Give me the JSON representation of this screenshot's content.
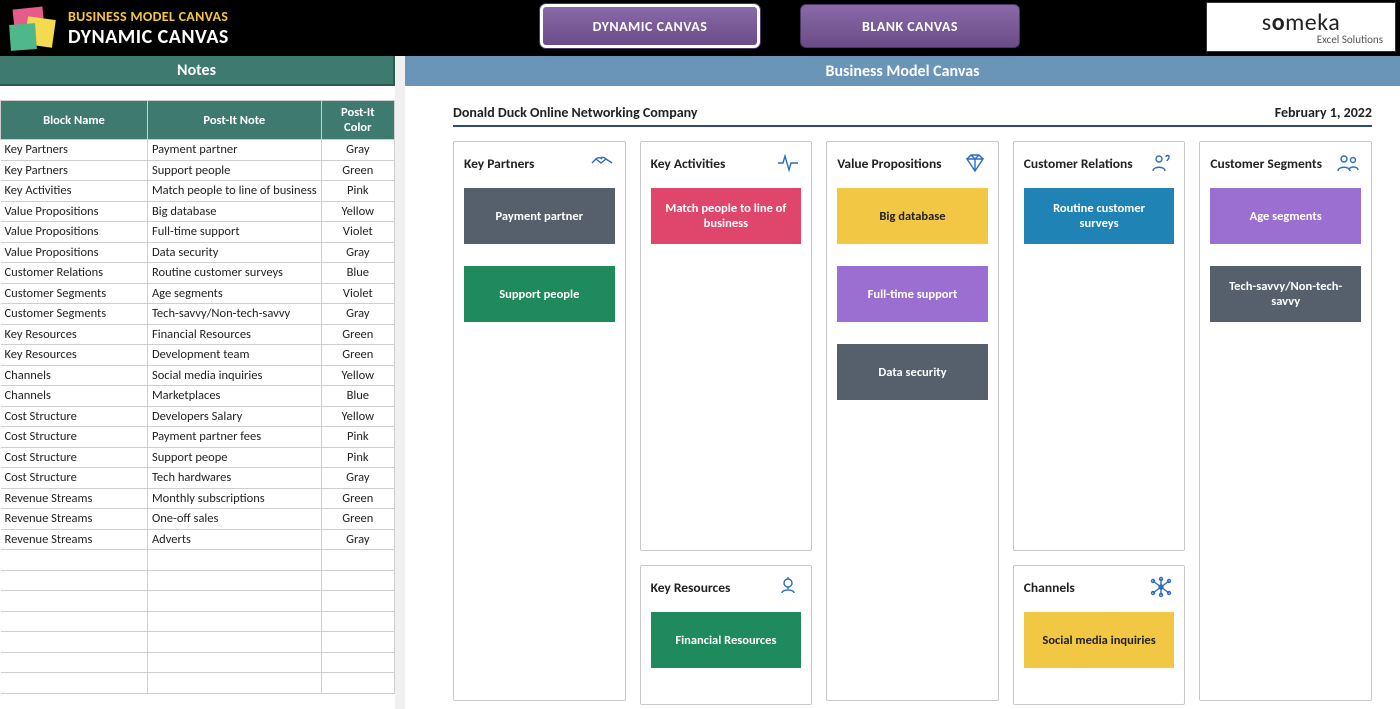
{
  "header": {
    "eyebrow": "BUSINESS MODEL CANVAS",
    "title": "DYNAMIC CANVAS",
    "nav": {
      "dynamic": "DYNAMIC CANVAS",
      "blank": "BLANK CANVAS"
    },
    "brand_main_a": "s",
    "brand_main_b": "o",
    "brand_main_c": "meka",
    "brand_sub": "Excel Solutions"
  },
  "section_headers": {
    "notes": "Notes",
    "canvas": "Business Model Canvas"
  },
  "notes_headers": {
    "block": "Block Name",
    "note": "Post-It Note",
    "color": "Post-It Color"
  },
  "notes": [
    {
      "block": "Key Partners",
      "note": "Payment partner",
      "color": "Gray"
    },
    {
      "block": "Key Partners",
      "note": "Support people",
      "color": "Green"
    },
    {
      "block": "Key Activities",
      "note": "Match people to line of business",
      "color": "Pink"
    },
    {
      "block": "Value Propositions",
      "note": "Big database",
      "color": "Yellow"
    },
    {
      "block": "Value Propositions",
      "note": "Full-time support",
      "color": "Violet"
    },
    {
      "block": "Value Propositions",
      "note": "Data security",
      "color": "Gray"
    },
    {
      "block": "Customer Relations",
      "note": "Routine customer surveys",
      "color": "Blue"
    },
    {
      "block": "Customer Segments",
      "note": "Age segments",
      "color": "Violet"
    },
    {
      "block": "Customer Segments",
      "note": "Tech-savvy/Non-tech-savvy",
      "color": "Gray"
    },
    {
      "block": "Key Resources",
      "note": "Financial Resources",
      "color": "Green"
    },
    {
      "block": "Key Resources",
      "note": "Development team",
      "color": "Green"
    },
    {
      "block": "Channels",
      "note": "Social media inquiries",
      "color": "Yellow"
    },
    {
      "block": "Channels",
      "note": "Marketplaces",
      "color": "Blue"
    },
    {
      "block": "Cost Structure",
      "note": "Developers Salary",
      "color": "Yellow"
    },
    {
      "block": "Cost Structure",
      "note": "Payment partner fees",
      "color": "Pink"
    },
    {
      "block": "Cost Structure",
      "note": "Support peope",
      "color": "Pink"
    },
    {
      "block": "Cost Structure",
      "note": "Tech hardwares",
      "color": "Gray"
    },
    {
      "block": "Revenue Streams",
      "note": "Monthly subscriptions",
      "color": "Green"
    },
    {
      "block": "Revenue Streams",
      "note": "One-off sales",
      "color": "Green"
    },
    {
      "block": "Revenue Streams",
      "note": "Adverts",
      "color": "Gray"
    },
    {
      "block": "",
      "note": "",
      "color": ""
    },
    {
      "block": "",
      "note": "",
      "color": ""
    },
    {
      "block": "",
      "note": "",
      "color": ""
    },
    {
      "block": "",
      "note": "",
      "color": ""
    },
    {
      "block": "",
      "note": "",
      "color": ""
    },
    {
      "block": "",
      "note": "",
      "color": ""
    },
    {
      "block": "",
      "note": "",
      "color": ""
    }
  ],
  "canvas_meta": {
    "company": "Donald Duck Online Networking Company",
    "date": "February 1, 2022"
  },
  "canvas_boxes": {
    "key_partners": {
      "title": "Key Partners"
    },
    "key_activities": {
      "title": "Key Activities"
    },
    "key_resources": {
      "title": "Key Resources"
    },
    "value_propositions": {
      "title": "Value Propositions"
    },
    "customer_relations": {
      "title": "Customer Relations"
    },
    "channels": {
      "title": "Channels"
    },
    "customer_segments": {
      "title": "Customer Segments"
    }
  },
  "postits": {
    "kp1": "Payment partner",
    "kp2": "Support people",
    "ka1": "Match people to line of business",
    "vp1": "Big database",
    "vp2": "Full-time support",
    "vp3": "Data security",
    "cr1": "Routine customer surveys",
    "cs1": "Age segments",
    "cs2": "Tech-savvy/Non-tech-savvy",
    "kr1": "Financial Resources",
    "ch1": "Social media inquiries"
  }
}
